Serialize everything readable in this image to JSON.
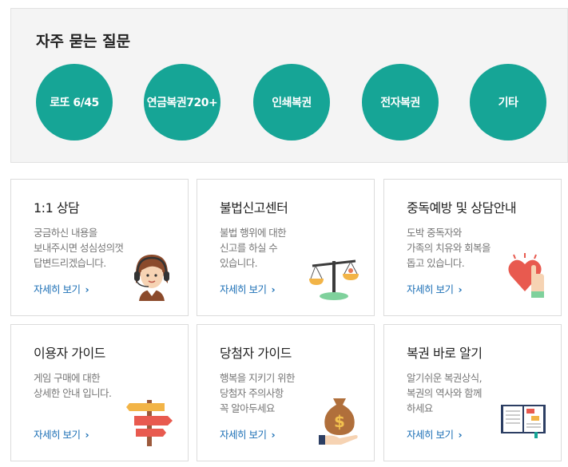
{
  "faq": {
    "title": "자주 묻는 질문",
    "items": [
      {
        "label": "로또 6/45"
      },
      {
        "label": "연금복권720+"
      },
      {
        "label": "인쇄복권"
      },
      {
        "label": "전자복권"
      },
      {
        "label": "기타"
      }
    ]
  },
  "colors": {
    "accent": "#16a596",
    "link": "#1a6eb5"
  },
  "cards": [
    {
      "title": "1:1 상담",
      "desc": "궁금하신 내용을\n보내주시면 성심성의껏\n답변드리겠습니다.",
      "link": "자세히 보기",
      "icon": "counselor-headset-icon"
    },
    {
      "title": "불법신고센터",
      "desc": "불법 행위에 대한\n신고를 하실 수\n있습니다.",
      "link": "자세히 보기",
      "icon": "balance-scale-icon"
    },
    {
      "title": "중독예방 및 상담안내",
      "desc": "도박 중독자와\n가족의 치유와 회복을\n돕고 있습니다.",
      "link": "자세히 보기",
      "icon": "heart-hand-icon"
    },
    {
      "title": "이용자 가이드",
      "desc": "게임 구매에 대한\n상세한 안내 입니다.",
      "link": "자세히 보기",
      "icon": "signpost-icon"
    },
    {
      "title": "당첨자 가이드",
      "desc": "행복을 지키기 위한\n당첨자 주의사항\n꼭 알아두세요",
      "link": "자세히 보기",
      "icon": "money-bag-icon"
    },
    {
      "title": "복권 바로 알기",
      "desc": "알기쉬운 복권상식,\n복권의 역사와 함께\n하세요",
      "link": "자세히 보기",
      "icon": "open-book-icon"
    }
  ]
}
